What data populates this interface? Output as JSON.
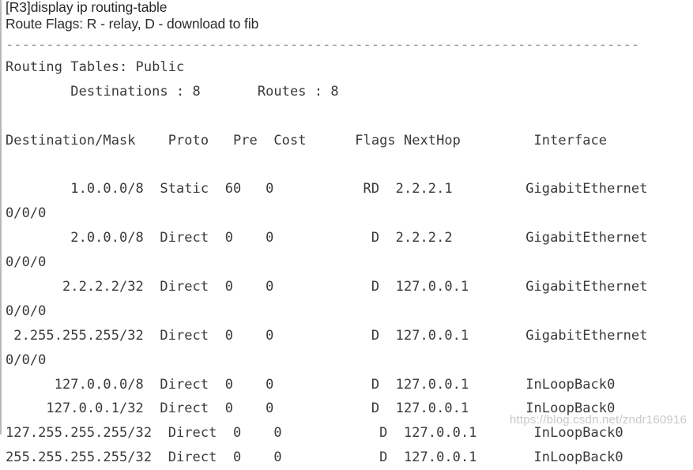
{
  "terminal": {
    "prompt_command": "[R3]display ip routing-table",
    "route_flags_legend": "Route Flags: R - relay, D - download to fib",
    "separator": "------------------------------------------------------------------------------",
    "routing_tables_label": "Routing Tables: Public",
    "summary_line": "        Destinations : 8       Routes : 8",
    "summary": {
      "destinations_label": "Destinations",
      "destinations_value": "8",
      "routes_label": "Routes",
      "routes_value": "8"
    },
    "columns": {
      "destination_mask": "Destination/Mask",
      "proto": "Proto",
      "pre": "Pre",
      "cost": "Cost",
      "flags": "Flags",
      "nexthop": "NextHop",
      "interface": "Interface"
    },
    "header_line": "Destination/Mask    Proto   Pre  Cost      Flags NextHop         Interface",
    "rows": [
      {
        "destination_mask": "1.0.0.0/8",
        "proto": "Static",
        "pre": "60",
        "cost": "0",
        "flags": "RD",
        "nexthop": "2.2.2.1",
        "interface": "GigabitEthernet",
        "interface_wrap": "0/0/0",
        "line1": "        1.0.0.0/8  Static  60   0           RD  2.2.2.1         GigabitEthernet",
        "line2": "0/0/0"
      },
      {
        "destination_mask": "2.0.0.0/8",
        "proto": "Direct",
        "pre": "0",
        "cost": "0",
        "flags": "D",
        "nexthop": "2.2.2.2",
        "interface": "GigabitEthernet",
        "interface_wrap": "0/0/0",
        "line1": "        2.0.0.0/8  Direct  0    0            D  2.2.2.2         GigabitEthernet",
        "line2": "0/0/0"
      },
      {
        "destination_mask": "2.2.2.2/32",
        "proto": "Direct",
        "pre": "0",
        "cost": "0",
        "flags": "D",
        "nexthop": "127.0.0.1",
        "interface": "GigabitEthernet",
        "interface_wrap": "0/0/0",
        "line1": "       2.2.2.2/32  Direct  0    0            D  127.0.0.1       GigabitEthernet",
        "line2": "0/0/0"
      },
      {
        "destination_mask": "2.255.255.255/32",
        "proto": "Direct",
        "pre": "0",
        "cost": "0",
        "flags": "D",
        "nexthop": "127.0.0.1",
        "interface": "GigabitEthernet",
        "interface_wrap": "0/0/0",
        "line1": " 2.255.255.255/32  Direct  0    0            D  127.0.0.1       GigabitEthernet",
        "line2": "0/0/0"
      },
      {
        "destination_mask": "127.0.0.0/8",
        "proto": "Direct",
        "pre": "0",
        "cost": "0",
        "flags": "D",
        "nexthop": "127.0.0.1",
        "interface": "InLoopBack0",
        "interface_wrap": "",
        "line1": "      127.0.0.0/8  Direct  0    0            D  127.0.0.1       InLoopBack0",
        "line2": ""
      },
      {
        "destination_mask": "127.0.0.1/32",
        "proto": "Direct",
        "pre": "0",
        "cost": "0",
        "flags": "D",
        "nexthop": "127.0.0.1",
        "interface": "InLoopBack0",
        "interface_wrap": "",
        "line1": "     127.0.0.1/32  Direct  0    0            D  127.0.0.1       InLoopBack0",
        "line2": ""
      },
      {
        "destination_mask": "127.255.255.255/32",
        "proto": "Direct",
        "pre": "0",
        "cost": "0",
        "flags": "D",
        "nexthop": "127.0.0.1",
        "interface": "InLoopBack0",
        "interface_wrap": "",
        "line1": "127.255.255.255/32  Direct  0    0            D  127.0.0.1       InLoopBack0",
        "line2": ""
      },
      {
        "destination_mask": "255.255.255.255/32",
        "proto": "Direct",
        "pre": "0",
        "cost": "0",
        "flags": "D",
        "nexthop": "127.0.0.1",
        "interface": "InLoopBack0",
        "interface_wrap": "",
        "line1": "255.255.255.255/32  Direct  0    0            D  127.0.0.1       InLoopBack0",
        "line2": ""
      }
    ]
  },
  "watermark": {
    "text": "https://blog.csdn.net/zndr160916"
  }
}
